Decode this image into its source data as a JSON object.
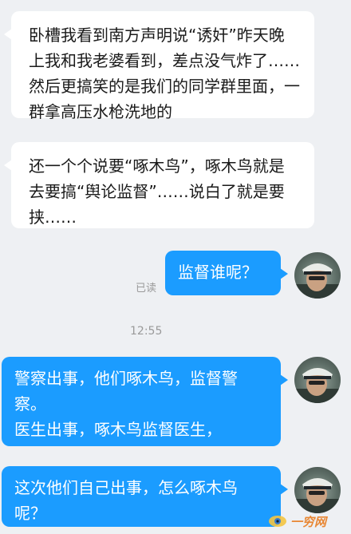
{
  "messages": [
    {
      "side": "left",
      "text": "卧槽我看到南方声明说“诱奸”昨天晚上我和我老婆看到，差点没气炸了……然后更搞笑的是我们的同学群里面，一群拿高压水枪洗地的"
    },
    {
      "side": "left",
      "text": "还一个个说要“啄木鸟”，啄木鸟就是去要搞“舆论监督”……说白了就是要挟……"
    },
    {
      "side": "right",
      "text": "监督谁呢？"
    },
    {
      "side": "right",
      "text": "警察出事，他们啄木鸟，监督警察。\n医生出事，啄木鸟监督医生，"
    },
    {
      "side": "right",
      "text": "这次他们自己出事，怎么啄木鸟呢？"
    }
  ],
  "read_status": "已读",
  "timestamp": "12:55",
  "watermark": "一穷网",
  "colors": {
    "background": "#eef0f3",
    "incoming_bubble": "#ffffff",
    "outgoing_bubble": "#1b9cff"
  }
}
